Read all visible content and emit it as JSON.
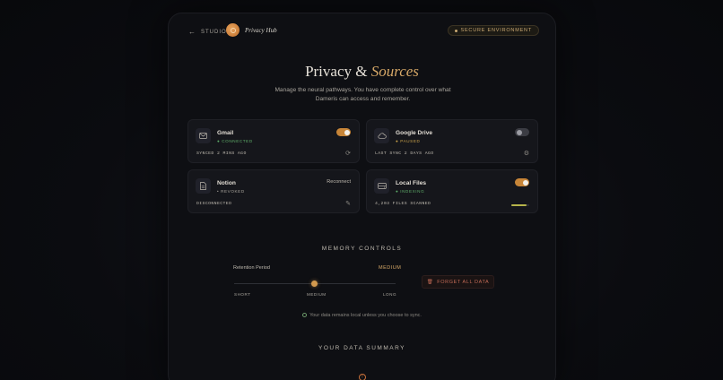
{
  "header": {
    "back_label": "STUDIO",
    "app_title": "Privacy Hub",
    "secure_badge": "SECURE ENVIRONMENT"
  },
  "hero": {
    "title_plain": "Privacy & ",
    "title_accent": "Sources",
    "subtitle": "Manage the neural pathways. You have complete control over what Dameris can access and remember."
  },
  "sources": [
    {
      "name": "Gmail",
      "status": "CONNECTED",
      "status_color": "#5fae6a",
      "meta": "SYNCED 2 MINS AGO",
      "enabled": true,
      "icon": "mail-icon",
      "action_icon": "refresh-icon"
    },
    {
      "name": "Google Drive",
      "status": "PAUSED",
      "status_color": "#c9a24a",
      "meta": "LAST SYNC 2 DAYS AGO",
      "enabled": false,
      "icon": "cloud-icon",
      "action_icon": "settings-icon"
    },
    {
      "name": "Notion",
      "status": "REVOKED",
      "status_color": "#8d8a84",
      "meta": "DISCONNECTED",
      "action_label": "Reconnect",
      "icon": "document-icon",
      "action_icon": "edit-icon"
    },
    {
      "name": "Local Files",
      "status": "INDEXING",
      "status_color": "#5fae6a",
      "meta": "4,203 FILES SCANNED",
      "enabled": true,
      "icon": "drive-icon",
      "progress": 0.85
    }
  ],
  "memory": {
    "heading": "MEMORY CONTROLS",
    "retention_label": "Retention Period",
    "retention_value": "MEDIUM",
    "ticks": [
      "SHORT",
      "MEDIUM",
      "LONG"
    ],
    "slider_position": 0.5,
    "forget_label": "FORGET ALL DATA",
    "note": "Your data remains local unless you choose to sync."
  },
  "summary": {
    "heading": "YOUR DATA SUMMARY"
  }
}
